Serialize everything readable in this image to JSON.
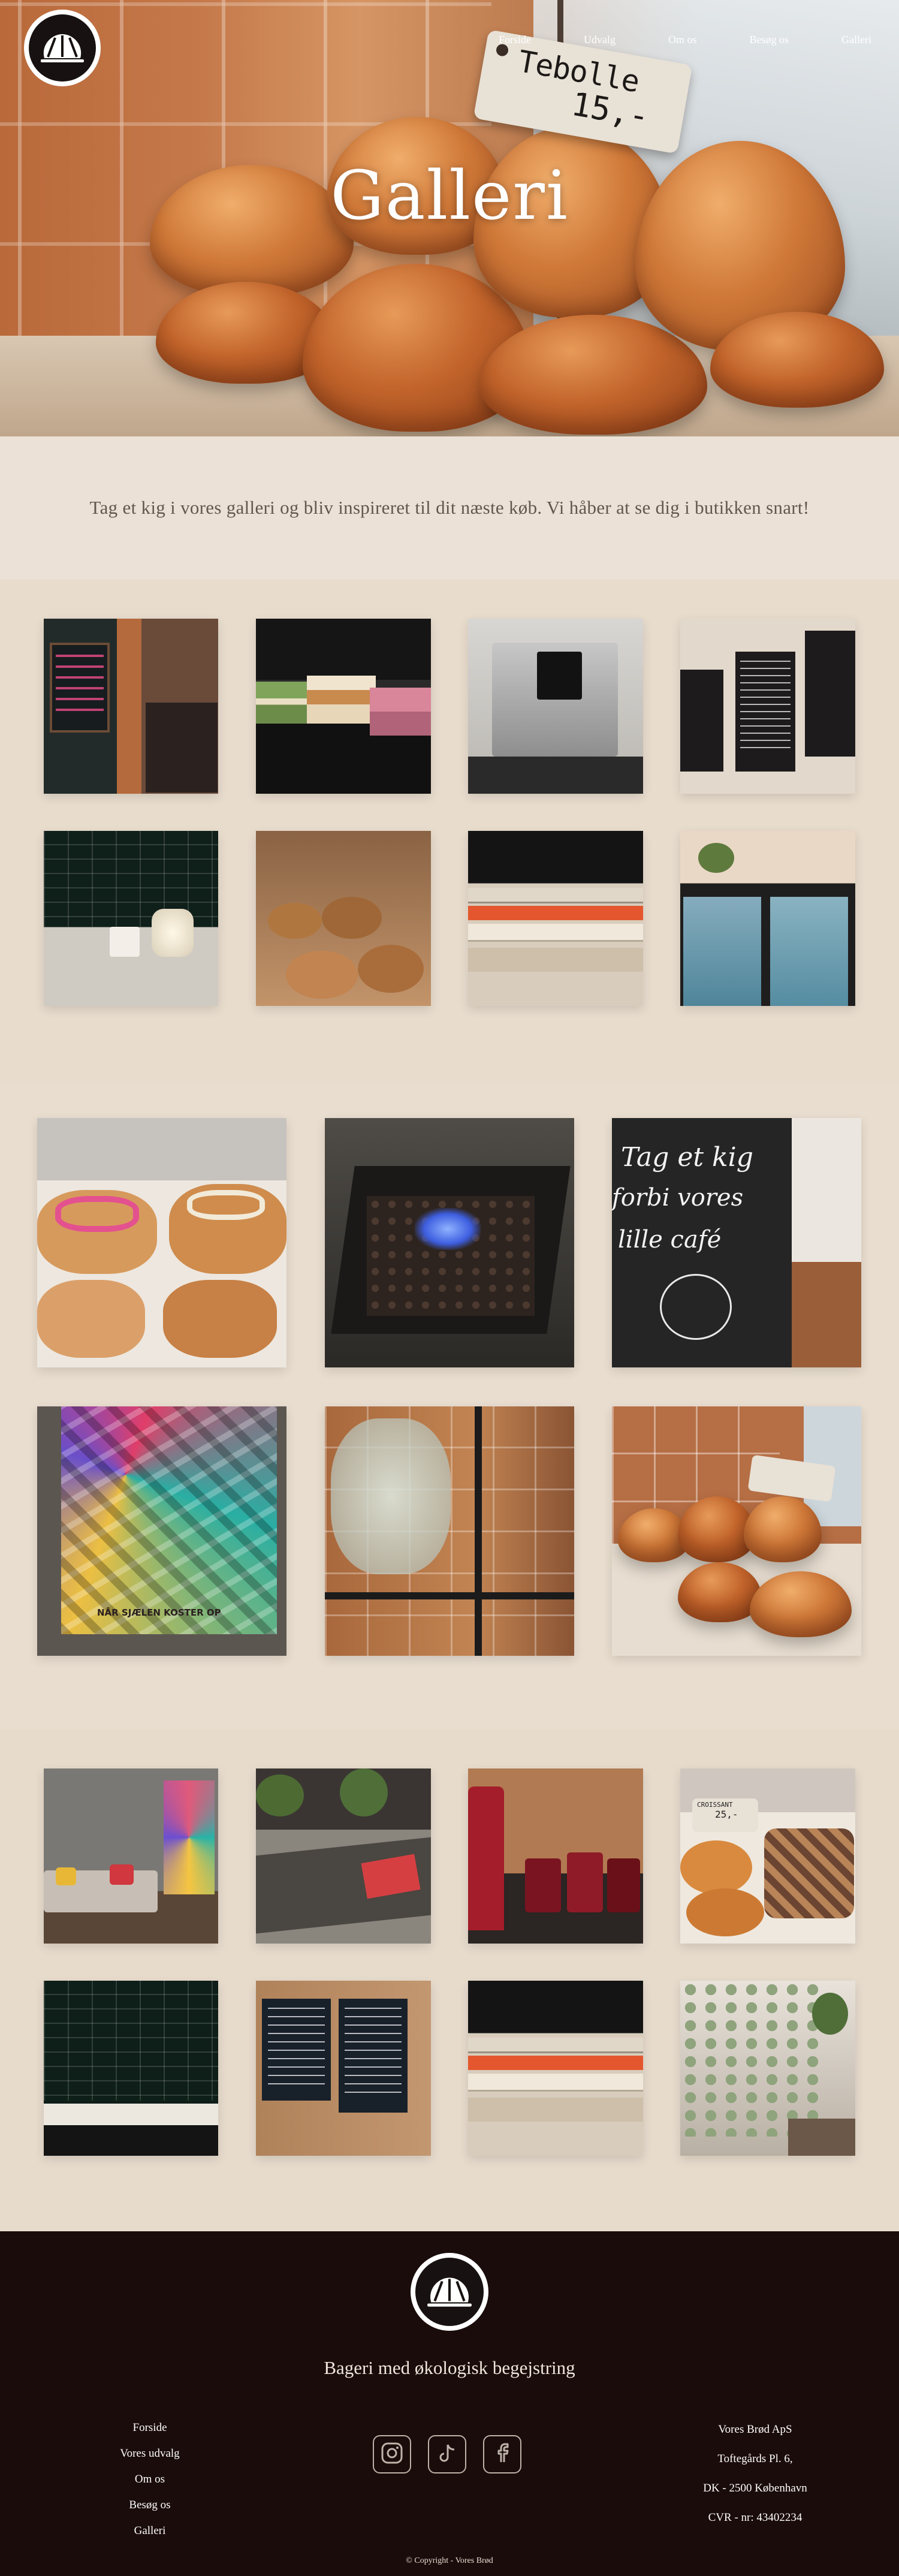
{
  "brand": {
    "name": "Vores Brød"
  },
  "nav": {
    "items": [
      {
        "label": "Forside"
      },
      {
        "label": "Udvalg"
      },
      {
        "label": "Om os"
      },
      {
        "label": "Besøg os"
      },
      {
        "label": "Galleri"
      }
    ]
  },
  "hero": {
    "title": "Galleri",
    "price_tag_name": "Tebolle",
    "price_tag_price": "15,-"
  },
  "intro": {
    "text": "Tag et kig i vores galleri og bliv inspireret til dit næste køb. Vi håber at se dig i butikken snart!"
  },
  "gallery": {
    "section1": [
      {
        "subject": "chalkboard-menu"
      },
      {
        "subject": "cakes-counter"
      },
      {
        "subject": "espresso-machine"
      },
      {
        "subject": "menu-boards"
      },
      {
        "subject": "tiled-corner"
      },
      {
        "subject": "bread-baskets"
      },
      {
        "subject": "book-stack"
      },
      {
        "subject": "fridge-shelves"
      }
    ],
    "section2": [
      {
        "subject": "glazed-pastries"
      },
      {
        "subject": "fire-table"
      },
      {
        "subject": "cafe-chalkboard",
        "text_line1": "Tag et kig",
        "text_line2": "forbi vores",
        "text_line3": "lille café"
      },
      {
        "subject": "art-tapestry",
        "caption": "NÅR SJÆLEN KOSTER OP"
      },
      {
        "subject": "water-dispenser"
      },
      {
        "subject": "buns-tebolle"
      }
    ],
    "section3": [
      {
        "subject": "lounge-sofa"
      },
      {
        "subject": "tables-plants"
      },
      {
        "subject": "jam-jars"
      },
      {
        "subject": "croissants",
        "sign": "CROISSANT",
        "sign_price": "25,-"
      },
      {
        "subject": "dark-tiles"
      },
      {
        "subject": "letter-boards"
      },
      {
        "subject": "book-stack-2"
      },
      {
        "subject": "hanging-plant"
      }
    ]
  },
  "footer": {
    "tagline": "Bageri med økologisk begejstring",
    "nav": [
      {
        "label": "Forside"
      },
      {
        "label": "Vores udvalg"
      },
      {
        "label": "Om os"
      },
      {
        "label": "Besøg os"
      },
      {
        "label": "Galleri"
      }
    ],
    "company": {
      "name": "Vores Brød ApS",
      "street": "Toftegårds Pl. 6,",
      "city": "DK - 2500 København",
      "cvr": "CVR - nr: 43402234"
    },
    "social": [
      {
        "icon": "instagram-icon"
      },
      {
        "icon": "tiktok-icon"
      },
      {
        "icon": "facebook-icon"
      }
    ],
    "copyright": "© Copyright - Vores Brød"
  },
  "colors": {
    "background": "#eddfd1",
    "footer": "#1a0c0a",
    "accent_text": "#5b4a3e"
  }
}
